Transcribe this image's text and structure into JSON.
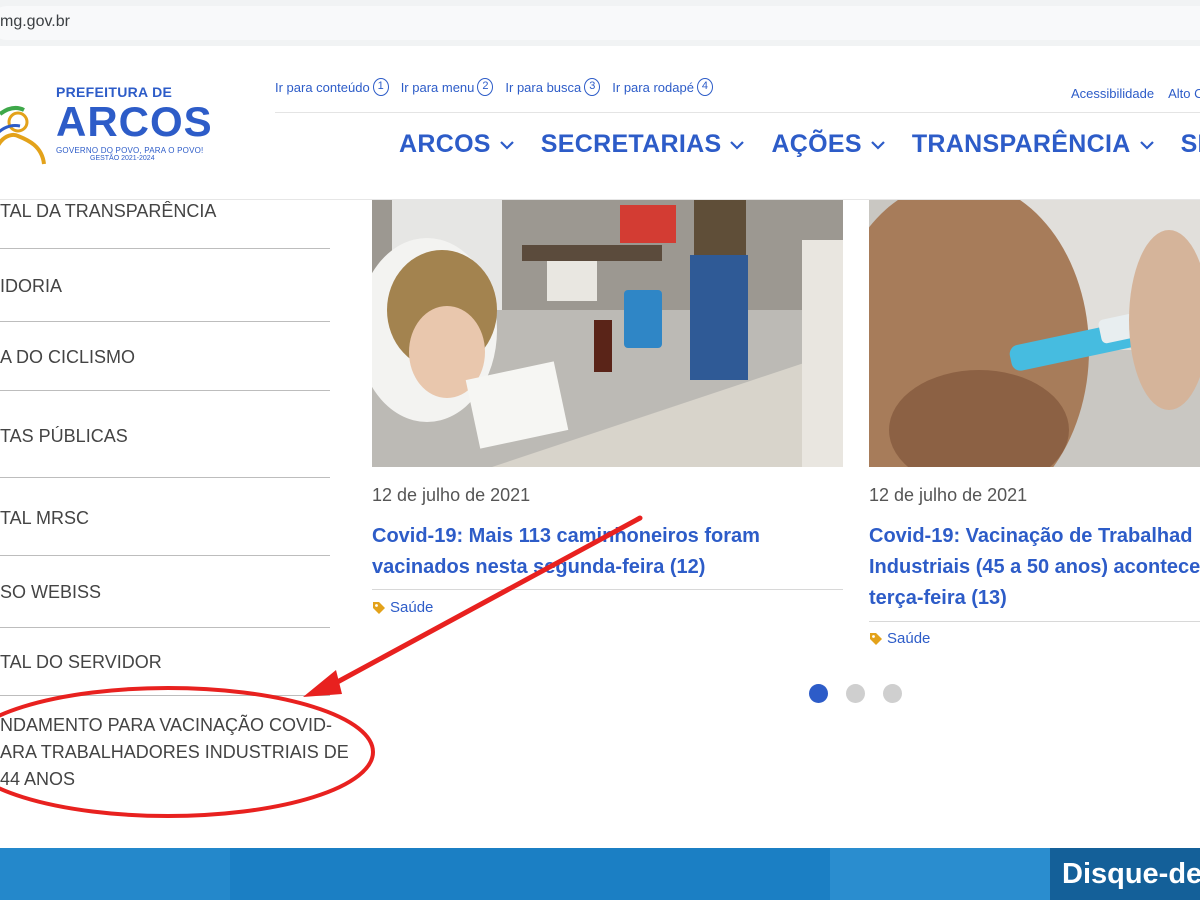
{
  "browser": {
    "url_fragment": "mg.gov.br"
  },
  "header": {
    "logo": {
      "prefix": "PREFEITURA DE",
      "name": "ARCOS",
      "tagline": "GOVERNO DO POVO, PARA O POVO!",
      "term": "GESTÃO 2021-2024"
    },
    "skip_links": [
      {
        "label": "Ir para conteúdo",
        "key": "1"
      },
      {
        "label": "Ir para menu",
        "key": "2"
      },
      {
        "label": "Ir para busca",
        "key": "3"
      },
      {
        "label": "Ir para rodapé",
        "key": "4"
      }
    ],
    "utility_links": [
      "Acessibilidade",
      "Alto C"
    ],
    "nav": [
      "ARCOS",
      "SECRETARIAS",
      "AÇÕES",
      "TRANSPARÊNCIA",
      "SERVI"
    ]
  },
  "sidebar": {
    "items": [
      "TAL DA TRANSPARÊNCIA",
      "IDORIA",
      "A DO CICLISMO",
      "TAS PÚBLICAS",
      "TAL MRSC",
      "SO WEBISS",
      "TAL DO SERVIDOR"
    ],
    "highlighted_item": [
      "NDAMENTO PARA VACINAÇÃO COVID-",
      "ARA TRABALHADORES INDUSTRIAIS DE",
      "44 ANOS"
    ]
  },
  "news": [
    {
      "date": "12 de julho de 2021",
      "title_lines": [
        "Covid-19: Mais 113 caminhoneiros foram",
        "vacinados nesta segunda-feira (12)"
      ],
      "tag": "Saúde"
    },
    {
      "date": "12 de julho de 2021",
      "title_lines": [
        "Covid-19: Vacinação de Trabalhad",
        "Industriais (45 a 50 anos) acontece",
        "terça-feira (13)"
      ],
      "tag": "Saúde"
    }
  ],
  "carousel": {
    "pages": 3,
    "active": 1
  },
  "banner": {
    "text": "Disque-de"
  },
  "colors": {
    "brand_blue": "#2d5cc8",
    "annotation_red": "#e8211f",
    "banner_blue": "#1b7fc4"
  }
}
